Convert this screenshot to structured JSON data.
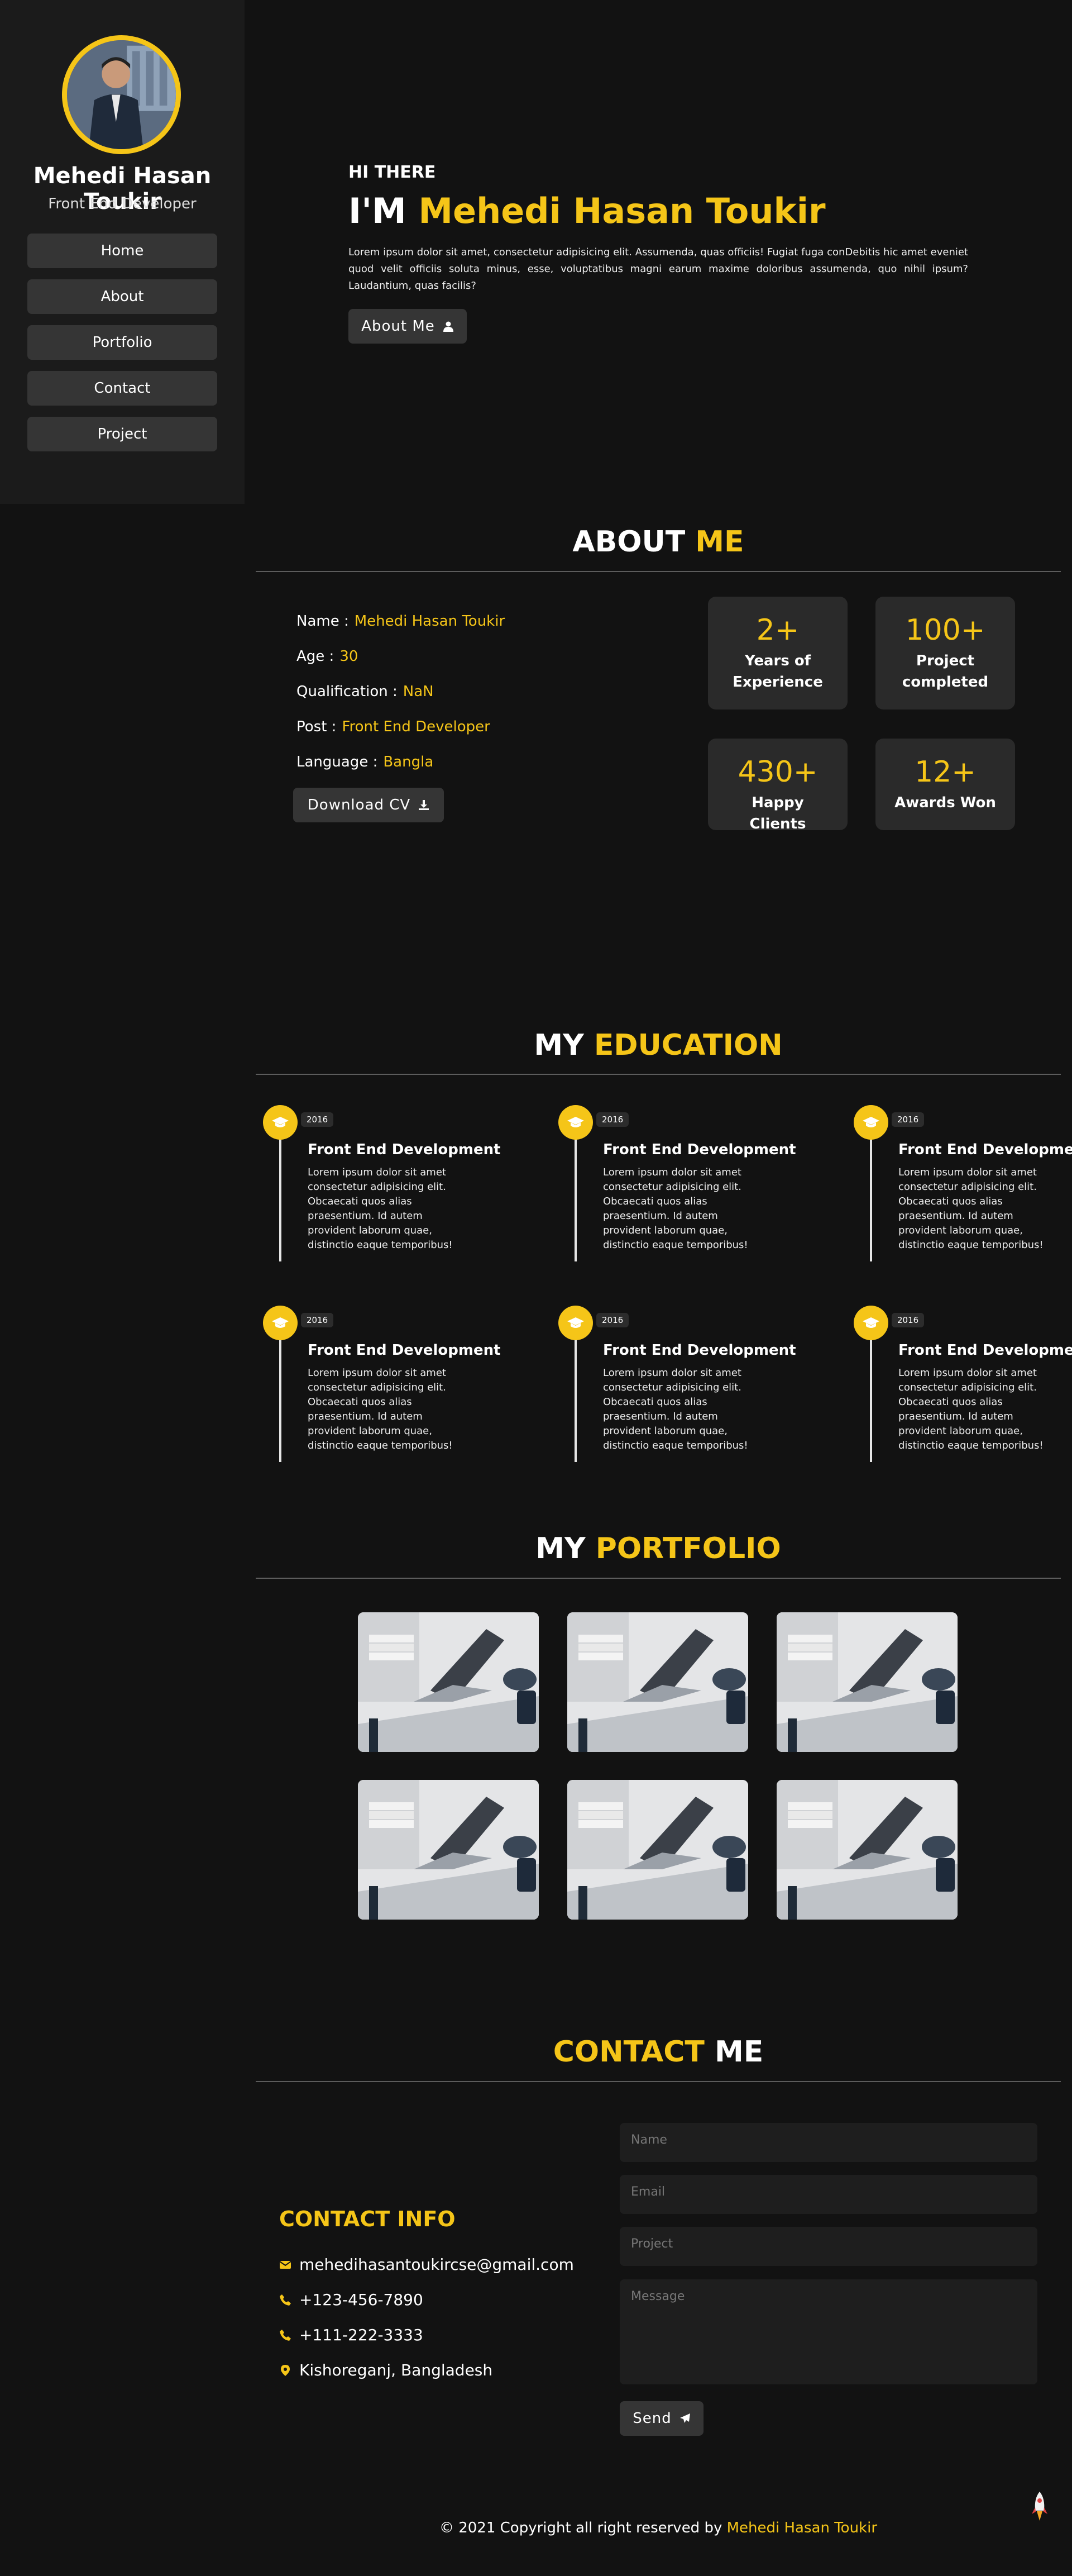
{
  "sidebar": {
    "name": "Mehedi Hasan Toukir",
    "role": "Front End Developer",
    "nav": [
      "Home",
      "About",
      "Portfolio",
      "Contact",
      "Project"
    ]
  },
  "hero": {
    "greeting": "HI THERE",
    "im": "I'M",
    "name": "Mehedi Hasan Toukir",
    "text": "Lorem ipsum dolor sit amet, consectetur adipisicing elit. Assumenda, quas officiis! Fugiat fuga conDebitis hic amet eveniet quod velit officiis soluta minus, esse, voluptatibus magni earum maxime doloribus assumenda, quo nihil ipsum? Laudantium, quas facilis?",
    "button": "About Me"
  },
  "about": {
    "head_white": "ABOUT",
    "head_yellow": "ME",
    "info": [
      {
        "key": "Name :",
        "value": "Mehedi Hasan Toukir"
      },
      {
        "key": "Age :",
        "value": "30"
      },
      {
        "key": "Qualification :",
        "value": "NaN"
      },
      {
        "key": "Post :",
        "value": "Front End Developer"
      },
      {
        "key": "Language :",
        "value": "Bangla"
      }
    ],
    "download": "Download CV",
    "stats": [
      {
        "num": "2+",
        "label": "Years of Experience"
      },
      {
        "num": "100+",
        "label": "Project completed"
      },
      {
        "num": "430+",
        "label": "Happy Clients"
      },
      {
        "num": "12+",
        "label": "Awards Won"
      }
    ]
  },
  "education": {
    "head_white": "MY",
    "head_yellow": "EDUCATION",
    "items": [
      {
        "year": "2016",
        "title": "Front End Development",
        "desc": "Lorem ipsum dolor sit amet consectetur adipisicing elit. Obcaecati quos alias praesentium. Id autem provident laborum quae, distinctio eaque temporibus!"
      },
      {
        "year": "2016",
        "title": "Front End Development",
        "desc": "Lorem ipsum dolor sit amet consectetur adipisicing elit. Obcaecati quos alias praesentium. Id autem provident laborum quae, distinctio eaque temporibus!"
      },
      {
        "year": "2016",
        "title": "Front End Development",
        "desc": "Lorem ipsum dolor sit amet consectetur adipisicing elit. Obcaecati quos alias praesentium. Id autem provident laborum quae, distinctio eaque temporibus!"
      },
      {
        "year": "2016",
        "title": "Front End Development",
        "desc": "Lorem ipsum dolor sit amet consectetur adipisicing elit. Obcaecati quos alias praesentium. Id autem provident laborum quae, distinctio eaque temporibus!"
      },
      {
        "year": "2016",
        "title": "Front End Development",
        "desc": "Lorem ipsum dolor sit amet consectetur adipisicing elit. Obcaecati quos alias praesentium. Id autem provident laborum quae, distinctio eaque temporibus!"
      },
      {
        "year": "2016",
        "title": "Front End Development",
        "desc": "Lorem ipsum dolor sit amet consectetur adipisicing elit. Obcaecati quos alias praesentium. Id autem provident laborum quae, distinctio eaque temporibus!"
      }
    ]
  },
  "portfolio": {
    "head_white": "MY",
    "head_yellow": "PORTFOLIO"
  },
  "contact": {
    "head_yellow": "CONTACT",
    "head_white": "ME",
    "info_title": "CONTACT INFO",
    "email": "mehedihasantoukircse@gmail.com",
    "phone1": "+123-456-7890",
    "phone2": "+111-222-3333",
    "address": "Kishoreganj, Bangladesh",
    "placeholders": {
      "name": "Name",
      "email": "Email",
      "project": "Project",
      "message": "Message"
    },
    "send": "Send"
  },
  "footer": {
    "text": "© 2021 Copyright all right reserved by",
    "name": "Mehedi Hasan Toukir"
  },
  "colors": {
    "accent": "#f5c518",
    "background": "#121212",
    "panel": "#1b1b1b"
  }
}
